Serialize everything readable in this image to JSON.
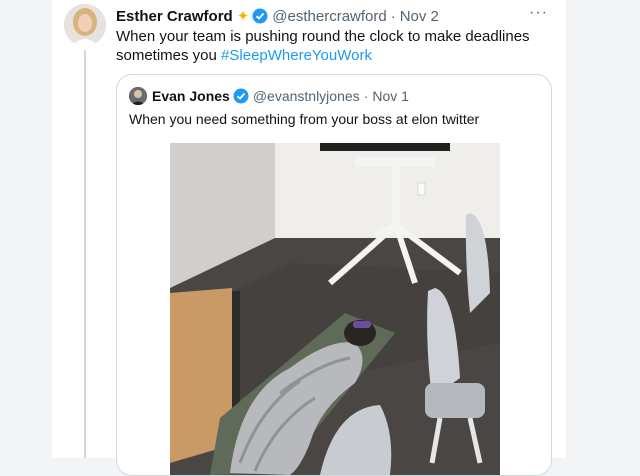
{
  "tweet": {
    "author_name": "Esther Crawford",
    "author_handle": "@esthercrawford",
    "separator": "·",
    "date": "Nov 2",
    "text_prefix": "When your team is pushing round the clock to make deadlines sometimes you ",
    "hashtag": "#SleepWhereYouWork",
    "more_label": "···",
    "sparkle_icon": "sparkle-icon",
    "verified_icon": "verified-badge-icon"
  },
  "quoted_tweet": {
    "author_name": "Evan Jones",
    "author_handle": "@evanstnlyjones",
    "separator": "·",
    "date": "Nov 1",
    "text": "When you need something from your boss at elon twitter",
    "verified_icon": "verified-badge-icon",
    "media_icon": "photo-sleeping-bag-office"
  },
  "colors": {
    "link": "#1d9bf0",
    "secondary_text": "#536471",
    "border": "#cfd9de"
  }
}
